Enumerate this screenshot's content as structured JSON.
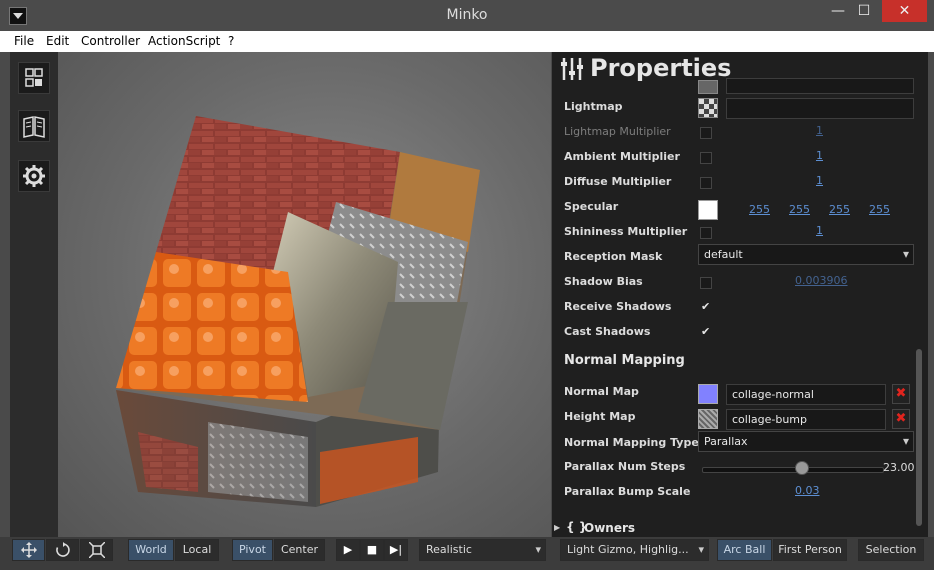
{
  "window": {
    "title": "Minko",
    "min_label": "—",
    "max_label": "☐",
    "close_label": "✕"
  },
  "menu": [
    "File",
    "Edit",
    "Controller",
    "ActionScript",
    "?"
  ],
  "properties": {
    "title": "Properties",
    "rows": {
      "lightmap": "Lightmap",
      "lightmap_multiplier": "Lightmap Multiplier",
      "lightmap_multiplier_value": "1",
      "ambient_multiplier": "Ambient Multiplier",
      "ambient_multiplier_value": "1",
      "diffuse_multiplier": "Diffuse Multiplier",
      "diffuse_multiplier_value": "1",
      "specular": "Specular",
      "specular_values": [
        "255",
        "255",
        "255",
        "255"
      ],
      "shininess_multiplier": "Shininess Multiplier",
      "shininess_multiplier_value": "1",
      "reception_mask": "Reception Mask",
      "reception_mask_value": "default",
      "shadow_bias": "Shadow Bias",
      "shadow_bias_value": "0.003906",
      "receive_shadows": "Receive Shadows",
      "receive_shadows_checked": true,
      "cast_shadows": "Cast Shadows",
      "cast_shadows_checked": true
    },
    "normal_mapping": {
      "title": "Normal Mapping",
      "normal_map": "Normal Map",
      "normal_map_value": "collage-normal",
      "height_map": "Height Map",
      "height_map_value": "collage-bump",
      "type_label": "Normal Mapping Type",
      "type_value": "Parallax",
      "steps_label": "Parallax Num Steps",
      "steps_value": "23.00",
      "steps_fraction": 0.55,
      "bump_label": "Parallax Bump Scale",
      "bump_value": "0.03"
    },
    "owners": {
      "braces": "{ }",
      "label": "Owners"
    }
  },
  "toolbar": {
    "world": "World",
    "local": "Local",
    "pivot": "Pivot",
    "center": "Center",
    "render_mode": "Realistic",
    "gizmo": "Light Gizmo, Highlig...",
    "arc_ball": "Arc Ball",
    "first_person": "First Person",
    "selection": "Selection"
  },
  "colors": {
    "accent_blue": "#3a5068",
    "link_blue": "#5d8fd2",
    "close_red": "#c7302a",
    "remove_red": "#e0241e"
  }
}
